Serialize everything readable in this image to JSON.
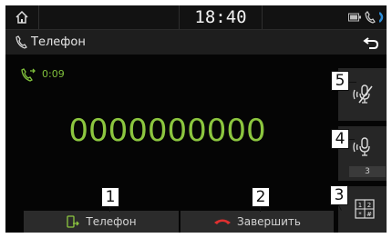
{
  "status_bar": {
    "time": "18:40"
  },
  "title_bar": {
    "title": "Телефон"
  },
  "call": {
    "duration": "0:09",
    "number": "0000000000"
  },
  "side_buttons": {
    "mic_level": "3"
  },
  "bottom_buttons": {
    "phone_label": "Телефон",
    "end_label": "Завершить"
  },
  "callouts": {
    "c1": "1",
    "c2": "2",
    "c3": "3",
    "c4": "4",
    "c5": "5"
  },
  "icons": {
    "home": "home-icon",
    "battery": "battery-icon",
    "phone_status": "phone-icon",
    "bluetooth": "bluetooth-icon",
    "title": "phone-handset-icon",
    "back": "back-arrow-icon",
    "call_active": "active-call-icon",
    "mute": "microphone-muted-icon",
    "mic": "microphone-volume-icon",
    "keypad": "keypad-icon",
    "transfer": "phone-transfer-icon",
    "end_call": "end-call-icon"
  },
  "colors": {
    "accent_green": "#8cc63f",
    "end_red": "#e03030",
    "background": "#050505"
  }
}
